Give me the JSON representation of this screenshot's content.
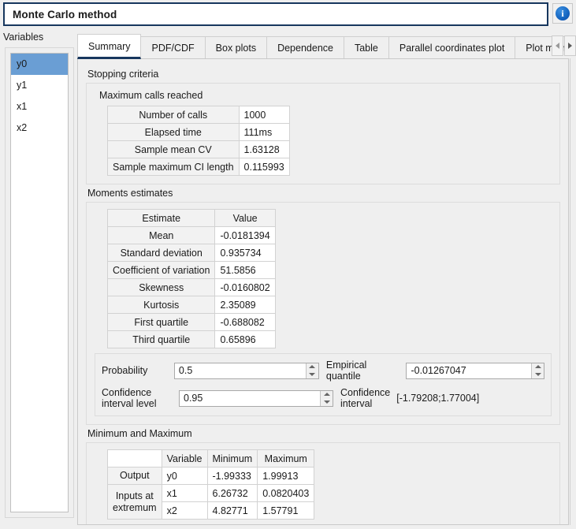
{
  "window": {
    "title": "Monte Carlo method",
    "info_icon": "info-icon",
    "info_glyph": "i"
  },
  "sidebar": {
    "label": "Variables",
    "items": [
      {
        "name": "y0",
        "selected": true
      },
      {
        "name": "y1",
        "selected": false
      },
      {
        "name": "x1",
        "selected": false
      },
      {
        "name": "x2",
        "selected": false
      }
    ]
  },
  "tabs": {
    "items": [
      "Summary",
      "PDF/CDF",
      "Box plots",
      "Dependence",
      "Table",
      "Parallel coordinates plot",
      "Plot matrix"
    ],
    "active": "Summary",
    "scroll_left_icon": "chevron-left-icon",
    "scroll_right_icon": "chevron-right-icon"
  },
  "summary": {
    "stopping_criteria": {
      "title": "Stopping criteria",
      "subtitle": "Maximum calls reached",
      "rows": [
        {
          "label": "Number of calls",
          "value": "1000"
        },
        {
          "label": "Elapsed time",
          "value": "111ms"
        },
        {
          "label": "Sample mean CV",
          "value": "1.63128"
        },
        {
          "label": "Sample maximum CI length",
          "value": "0.115993"
        }
      ]
    },
    "moments": {
      "title": "Moments estimates",
      "headers": [
        "Estimate",
        "Value"
      ],
      "rows": [
        {
          "label": "Mean",
          "value": "-0.0181394"
        },
        {
          "label": "Standard deviation",
          "value": "0.935734"
        },
        {
          "label": "Coefficient of variation",
          "value": "51.5856"
        },
        {
          "label": "Skewness",
          "value": "-0.0160802"
        },
        {
          "label": "Kurtosis",
          "value": "2.35089"
        },
        {
          "label": "First quartile",
          "value": "-0.688082"
        },
        {
          "label": "Third quartile",
          "value": "0.65896"
        }
      ]
    },
    "quantile": {
      "probability_label": "Probability",
      "probability_value": "0.5",
      "empirical_quantile_label": "Empirical quantile",
      "empirical_quantile_value": "-0.01267047",
      "confidence_level_label": "Confidence\ninterval level",
      "confidence_level_value": "0.95",
      "confidence_interval_label": "Confidence\ninterval",
      "confidence_interval_value": "[-1.79208;1.77004]"
    },
    "minmax": {
      "title": "Minimum and Maximum",
      "headers": [
        "",
        "Variable",
        "Minimum",
        "Maximum"
      ],
      "output_row_label": "Output",
      "inputs_row_label": "Inputs at\nextremum",
      "rows": [
        {
          "group": "Output",
          "variable": "y0",
          "minimum": "-1.99333",
          "maximum": "1.99913"
        },
        {
          "group": "Inputs at extremum",
          "variable": "x1",
          "minimum": "6.26732",
          "maximum": "0.0820403"
        },
        {
          "group": "Inputs at extremum",
          "variable": "x2",
          "minimum": "4.82771",
          "maximum": "1.57791"
        }
      ]
    }
  },
  "colors": {
    "title_border": "#17375e",
    "selection": "#6a9ed4",
    "active_tab_underline": "#17375e",
    "background": "#efefef"
  }
}
